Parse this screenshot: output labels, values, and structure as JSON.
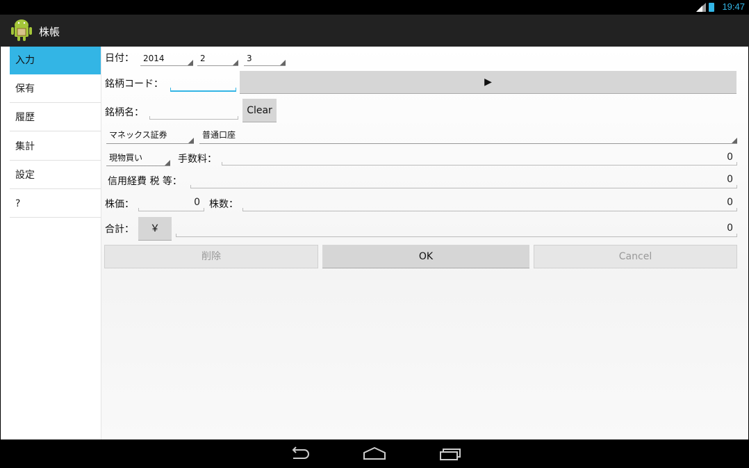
{
  "status": {
    "time": "19:47",
    "network": "3G"
  },
  "app": {
    "title": "株帳"
  },
  "sidebar": {
    "items": [
      {
        "label": "入力",
        "active": true
      },
      {
        "label": "保有"
      },
      {
        "label": "履歴"
      },
      {
        "label": "集計"
      },
      {
        "label": "設定"
      },
      {
        "label": "?"
      }
    ]
  },
  "form": {
    "date_label": "日付：",
    "year": "2014",
    "month": "2",
    "day": "3",
    "code_label": "銘柄コード：",
    "code_value": "",
    "go_button": "▶",
    "name_label": "銘柄名：",
    "name_value": "",
    "clear_button": "Clear",
    "broker": "マネックス証券",
    "account": "普通口座",
    "trade_type": "現物買い",
    "fee_label": "手数料：",
    "fee_value": "0",
    "margin_label": "信用経費 税 等：",
    "margin_value": "0",
    "price_label": "株価：",
    "price_value": "0",
    "shares_label": "株数：",
    "shares_value": "0",
    "total_label": "合計：",
    "yen_button": "￥",
    "total_value": "0",
    "delete_button": "削除",
    "ok_button": "OK",
    "cancel_button": "Cancel"
  },
  "colors": {
    "accent": "#33b5e5",
    "actionbar": "#222222"
  }
}
